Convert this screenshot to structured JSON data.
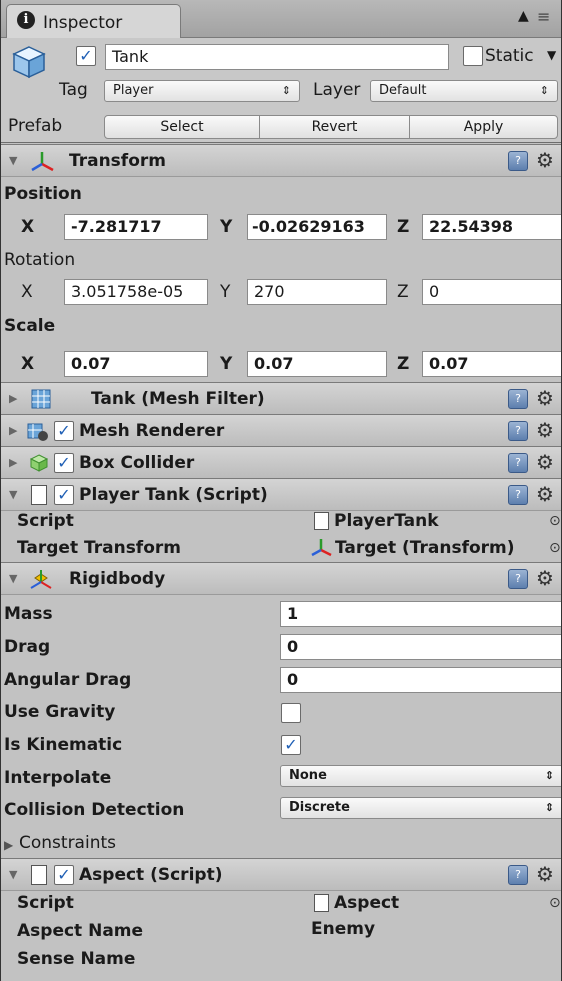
{
  "tab": {
    "title": "Inspector"
  },
  "object": {
    "name": "Tank",
    "active": true,
    "static_label": "Static",
    "static_checked": false
  },
  "tag": {
    "label": "Tag",
    "value": "Player"
  },
  "layer": {
    "label": "Layer",
    "value": "Default"
  },
  "prefab": {
    "label": "Prefab",
    "select": "Select",
    "revert": "Revert",
    "apply": "Apply"
  },
  "transform": {
    "title": "Transform",
    "position_label": "Position",
    "position": {
      "x_label": "X",
      "x": "-7.281717",
      "y_label": "Y",
      "y": "-0.02629163",
      "z_label": "Z",
      "z": "22.54398"
    },
    "rotation_label": "Rotation",
    "rotation": {
      "x_label": "X",
      "x": "3.051758e-05",
      "y_label": "Y",
      "y": "270",
      "z_label": "Z",
      "z": "0"
    },
    "scale_label": "Scale",
    "scale": {
      "x_label": "X",
      "x": "0.07",
      "y_label": "Y",
      "y": "0.07",
      "z_label": "Z",
      "z": "0.07"
    }
  },
  "mesh_filter": {
    "title": "Tank (Mesh Filter)"
  },
  "mesh_renderer": {
    "title": "Mesh Renderer",
    "enabled": true
  },
  "box_collider": {
    "title": "Box Collider",
    "enabled": true
  },
  "player_tank": {
    "title": "Player Tank (Script)",
    "enabled": true,
    "script_label": "Script",
    "script_value": "PlayerTank",
    "target_label": "Target Transform",
    "target_value": "Target (Transform)"
  },
  "rigidbody": {
    "title": "Rigidbody",
    "mass_label": "Mass",
    "mass": "1",
    "drag_label": "Drag",
    "drag": "0",
    "angular_drag_label": "Angular Drag",
    "angular_drag": "0",
    "use_gravity_label": "Use Gravity",
    "use_gravity": false,
    "is_kinematic_label": "Is Kinematic",
    "is_kinematic": true,
    "interpolate_label": "Interpolate",
    "interpolate": "None",
    "collision_label": "Collision Detection",
    "collision": "Discrete",
    "constraints_label": "Constraints"
  },
  "aspect": {
    "title": "Aspect (Script)",
    "enabled": true,
    "script_label": "Script",
    "script_value": "Aspect",
    "aspect_name_label": "Aspect Name",
    "aspect_name_value": "Enemy",
    "sense_name_label": "Sense Name"
  },
  "icons": {
    "check": "✓",
    "fold_open": "▼",
    "fold_closed": "▶",
    "gear": "⚙",
    "help": "?",
    "lock": "🔒",
    "menu": "≡",
    "info": "i",
    "dropdown": "⇕",
    "picker": "⊙"
  }
}
